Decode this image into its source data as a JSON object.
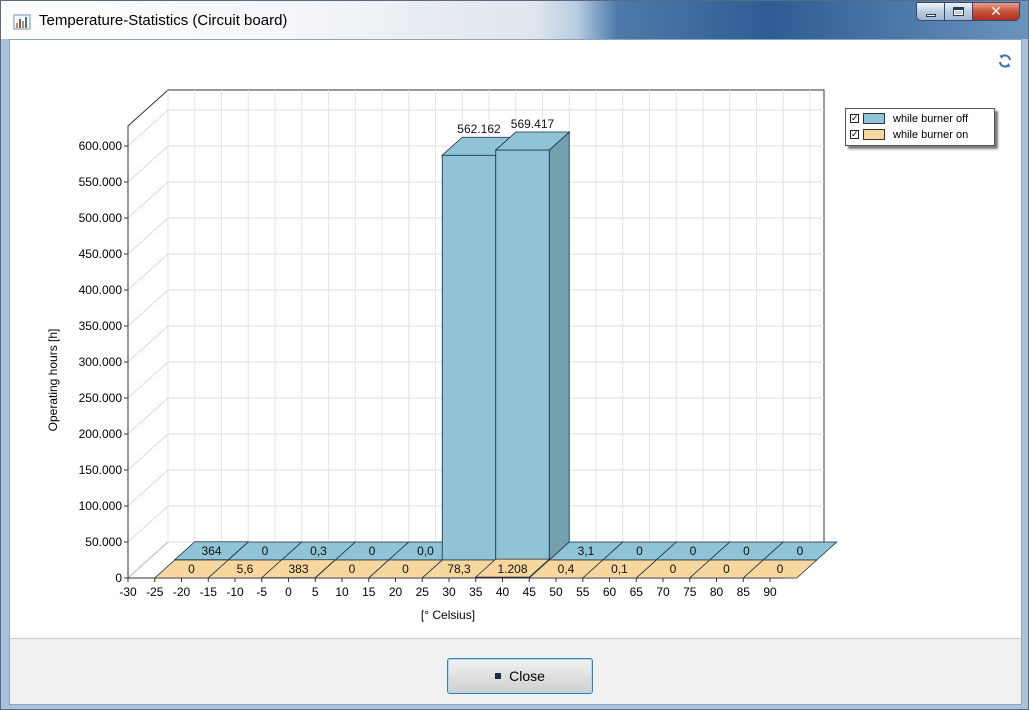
{
  "window": {
    "title": "Temperature-Statistics (Circuit board)"
  },
  "colors": {
    "off": "#8ec4d6",
    "on": "#f7d79d",
    "accent": "#3c7fb1"
  },
  "icons": {
    "app": "chart-app-icon",
    "refresh": "refresh-icon",
    "minimize": "minimize-icon",
    "maximize": "maximize-icon",
    "close": "close-icon"
  },
  "footer": {
    "close_label": "Close"
  },
  "chart_data": {
    "type": "bar",
    "style": "3d-stacked-rows",
    "title": "",
    "xlabel": "[° Celsius]",
    "ylabel": "Operating hours [h]",
    "ylim": [
      0,
      600000
    ],
    "yticks": [
      "0",
      "50.000",
      "100.000",
      "150.000",
      "200.000",
      "250.000",
      "300.000",
      "350.000",
      "400.000",
      "450.000",
      "500.000",
      "550.000",
      "600.000"
    ],
    "xticks": [
      "-30",
      "-25",
      "-20",
      "-15",
      "-10",
      "-5",
      "0",
      "5",
      "10",
      "15",
      "20",
      "25",
      "30",
      "35",
      "40",
      "45",
      "50",
      "55",
      "60",
      "65",
      "70",
      "75",
      "80",
      "85",
      "90"
    ],
    "categories": [
      "-30 to -20",
      "-20 to -10",
      "-10 to 0",
      "0 to 10",
      "10 to 20",
      "20 to 30",
      "30 to 40",
      "40 to 50",
      "50 to 60",
      "60 to 70",
      "70 to 80",
      "80 to 90"
    ],
    "grid": true,
    "legend_position": "top-right",
    "series": [
      {
        "name": "while burner off",
        "values": [
          364,
          0,
          0.3,
          0,
          0.0,
          562162,
          569417,
          3.1,
          0,
          0,
          0,
          0
        ],
        "labels": [
          "364",
          "0",
          "0,3",
          "0",
          "0,0",
          "562.162",
          "569.417",
          "3,1",
          "0",
          "0",
          "0",
          "0"
        ]
      },
      {
        "name": "while burner on",
        "values": [
          0,
          5.6,
          383,
          0,
          0,
          78.3,
          1208,
          0.4,
          0.1,
          0,
          0,
          0
        ],
        "labels": [
          "0",
          "5,6",
          "383",
          "0",
          "0",
          "78,3",
          "1.208",
          "0,4",
          "0,1",
          "0",
          "0",
          "0"
        ]
      }
    ]
  }
}
